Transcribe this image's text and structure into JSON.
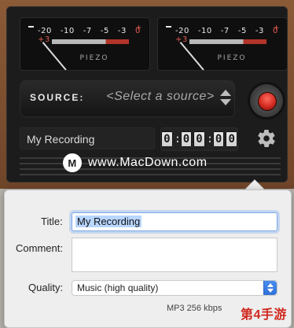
{
  "meters": [
    {
      "scale": [
        "-20",
        "-10",
        "-7",
        "-5",
        "-3"
      ],
      "scale_hot": [
        "0",
        "+3"
      ],
      "label": "PIEZO"
    },
    {
      "scale": [
        "-20",
        "-10",
        "-7",
        "-5",
        "-3"
      ],
      "scale_hot": [
        "0",
        "+3"
      ],
      "label": "PIEZO"
    }
  ],
  "source": {
    "label": "SOURCE:",
    "value": "<Select a source>"
  },
  "recording": {
    "name": "My Recording",
    "timer": [
      "0",
      "0",
      "0",
      "0",
      "0"
    ]
  },
  "watermark": {
    "logo": "M",
    "text": "www.MacDown.com"
  },
  "form": {
    "title_label": "Title:",
    "title_value": "My Recording",
    "comment_label": "Comment:",
    "quality_label": "Quality:",
    "quality_value": "Music (high quality)",
    "format": "MP3 256 kbps"
  },
  "brand": {
    "text": "第4手游",
    "color": "#d0281e"
  },
  "icons": [
    "gear-icon",
    "record-icon",
    "stepper-icon",
    "dropdown-icon"
  ]
}
